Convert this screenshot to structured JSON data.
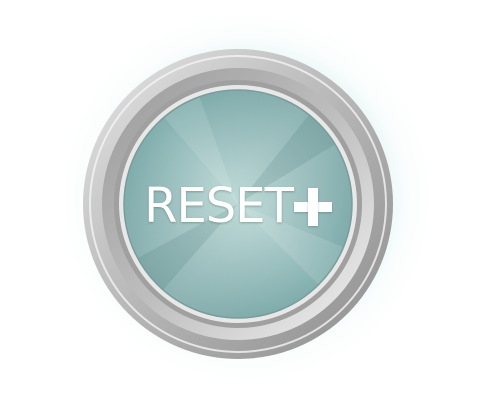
{
  "button": {
    "label": "RESET",
    "icon": "plus-icon"
  },
  "colors": {
    "face_teal": "#6fa8a8",
    "face_highlight": "#c2e4dc",
    "bezel_silver": "#c8c8c8",
    "glow": "#cfeaea"
  }
}
